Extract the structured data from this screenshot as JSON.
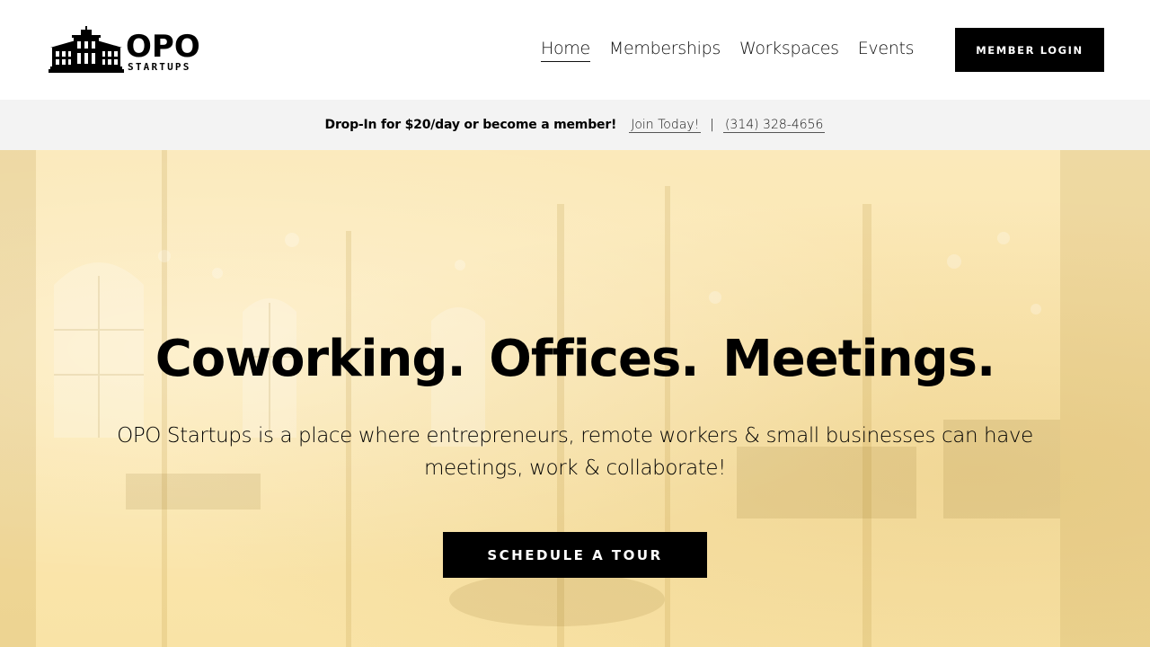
{
  "header": {
    "logo": {
      "word": "OPO",
      "sub": "STARTUPS",
      "icon": "building-icon"
    },
    "nav": [
      {
        "label": "Home",
        "active": true
      },
      {
        "label": "Memberships",
        "active": false
      },
      {
        "label": "Workspaces",
        "active": false
      },
      {
        "label": "Events",
        "active": false
      }
    ],
    "member_login": "MEMBER LOGIN"
  },
  "announcement": {
    "text": "Drop-In for $20/day or become a member!",
    "join_link": "Join Today!",
    "separator": "|",
    "phone_link": "(314) 328-4656"
  },
  "hero": {
    "title": "Coworking.  Offices.  Meetings.",
    "subtitle": "OPO Startups is a place where entrepreneurs, remote workers & small businesses can have meetings, work & collaborate!",
    "cta": "SCHEDULE A TOUR",
    "overlay_color": "#fce8b3"
  },
  "colors": {
    "accent": "#000000",
    "announce_bg": "#f3f3f3"
  }
}
